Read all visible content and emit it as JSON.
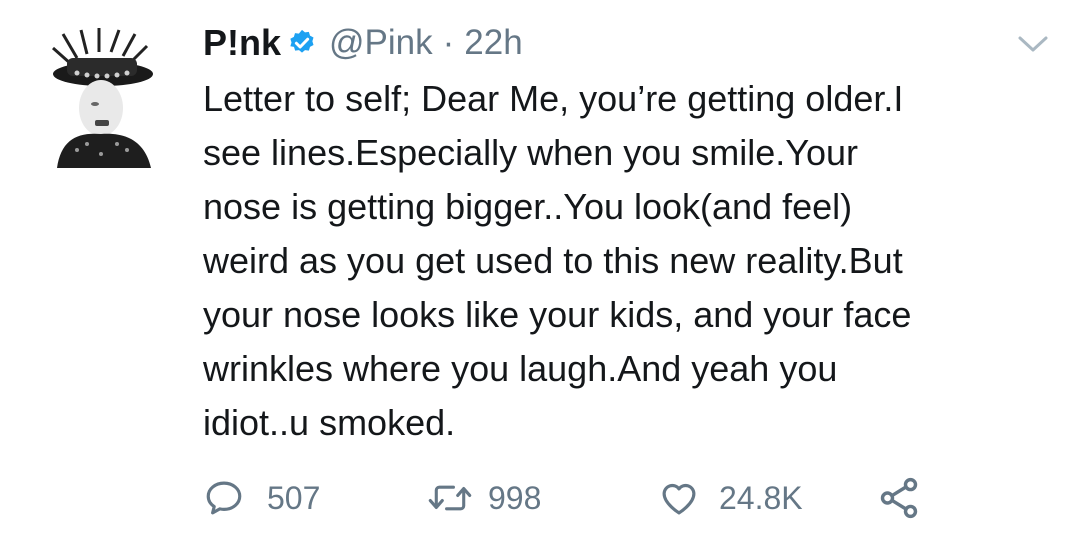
{
  "tweet": {
    "display_name": "P!nk",
    "handle": "@Pink",
    "separator": "·",
    "time": "22h",
    "text": "Letter to self; Dear Me, you’re getting older.I\nsee lines.Especially when you smile.Your\nnose is getting bigger..You look(and feel)\nweird as you get used to this new reality.But\nyour nose looks like your kids, and your face\nwrinkles where you laugh.And yeah you\nidiot..u smoked."
  },
  "actions": {
    "reply_count": "507",
    "retweet_count": "998",
    "like_count": "24.8K"
  },
  "icons": {
    "verified": "verified-badge-icon",
    "menu": "chevron-down-icon",
    "reply": "reply-icon",
    "retweet": "retweet-icon",
    "like": "heart-icon",
    "share": "share-icon"
  },
  "colors": {
    "text": "#14171a",
    "muted": "#657786",
    "verified_blue": "#1da1f2",
    "icon_gray": "#657786",
    "chevron": "#aab8c2"
  }
}
